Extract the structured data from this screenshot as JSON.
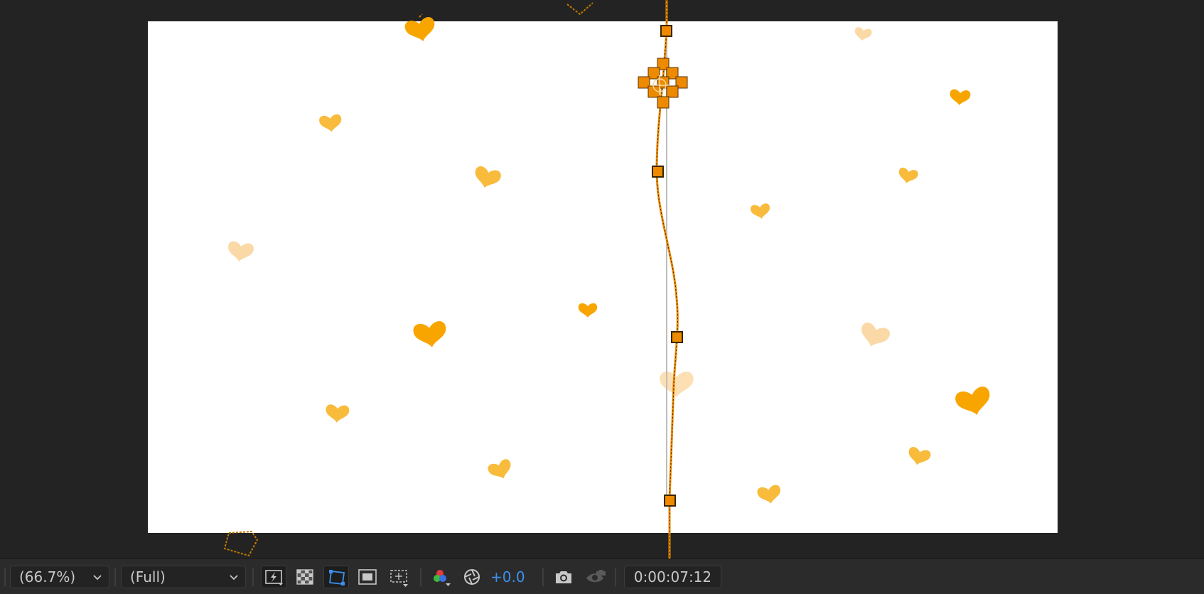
{
  "toolbar": {
    "magnification": "(66.7%)",
    "resolution": "(Full)",
    "exposure": "+0.0",
    "timecode": "0:00:07:12",
    "icons": [
      "fast-previews-icon",
      "transparency-grid-icon",
      "mask-path-visibility-icon",
      "region-of-interest-icon",
      "target-region-icon",
      "color-channels-icon",
      "reset-exposure-icon",
      "snapshot-icon",
      "show-snapshot-icon"
    ]
  },
  "colors": {
    "heart_primary": "#f9a500",
    "heart_mid": "#f8bb3c",
    "heart_light": "#fbd9a6",
    "path_orange": "#ee8a00",
    "exposure_blue": "#3d8ff0",
    "panel_bg": "#232323",
    "toolbar_bg": "#2b2b2b"
  }
}
